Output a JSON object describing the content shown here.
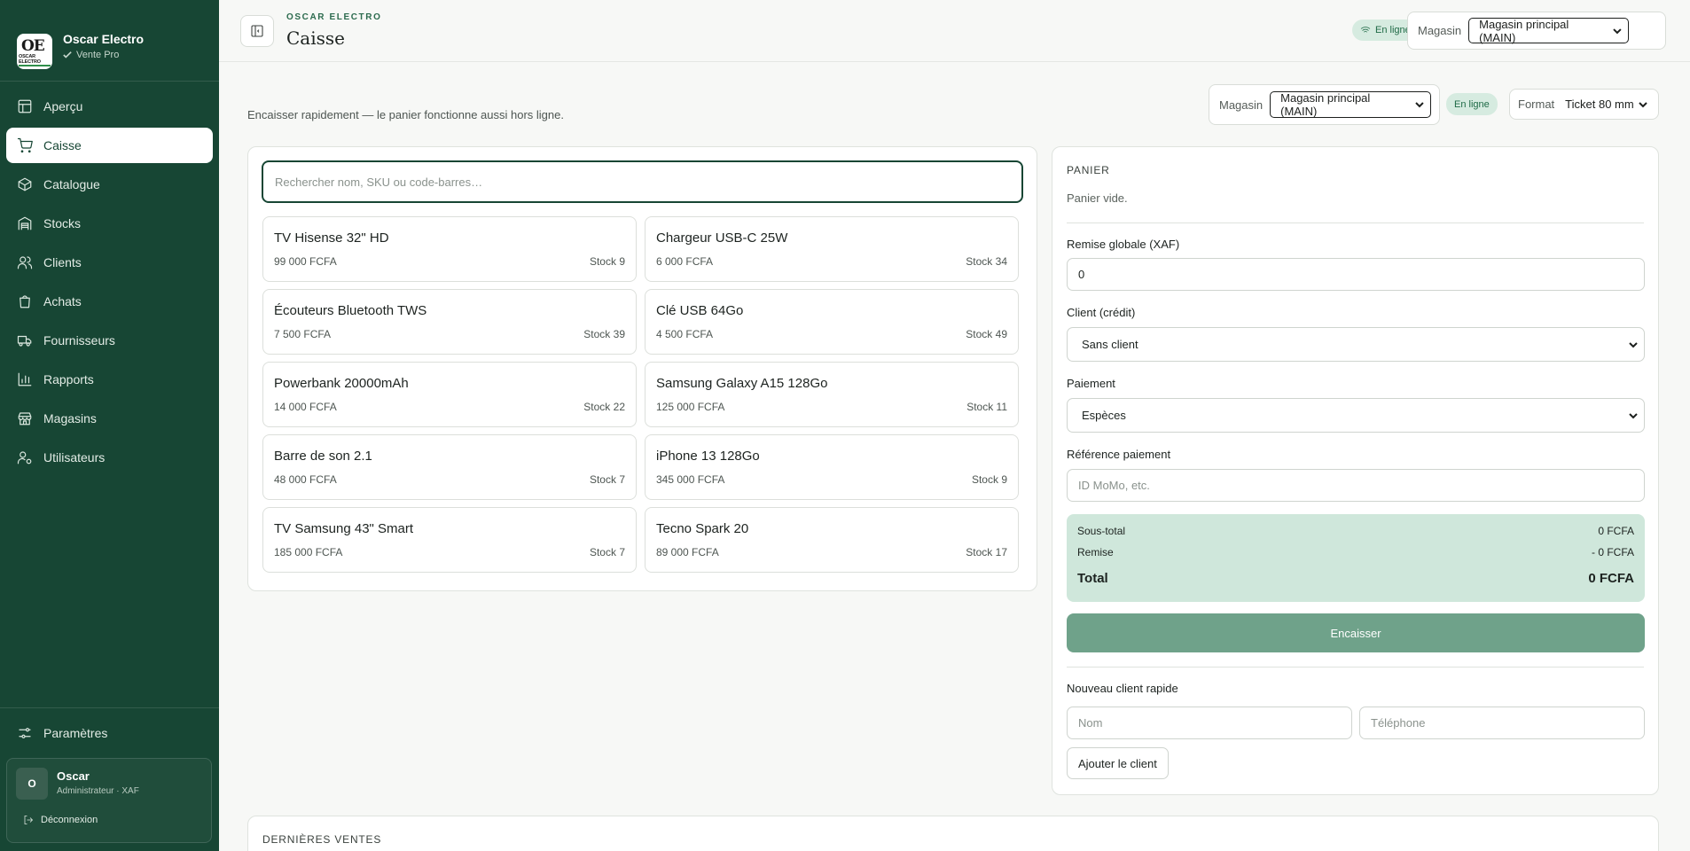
{
  "sidebar": {
    "brand_name": "Oscar Electro",
    "brand_sub": "Vente Pro",
    "logo_text": "OE",
    "logo_small": "OSCAR ELECTRO",
    "items": [
      {
        "label": "Aperçu",
        "icon": "layout-grid-icon"
      },
      {
        "label": "Caisse",
        "icon": "shopping-cart-icon",
        "active": true
      },
      {
        "label": "Catalogue",
        "icon": "package-icon"
      },
      {
        "label": "Stocks",
        "icon": "warehouse-icon"
      },
      {
        "label": "Clients",
        "icon": "users-icon"
      },
      {
        "label": "Achats",
        "icon": "shopping-bag-icon"
      },
      {
        "label": "Fournisseurs",
        "icon": "truck-icon"
      },
      {
        "label": "Rapports",
        "icon": "bar-chart-icon"
      },
      {
        "label": "Magasins",
        "icon": "store-icon"
      },
      {
        "label": "Utilisateurs",
        "icon": "user-cog-icon"
      }
    ],
    "settings_label": "Paramètres",
    "user": {
      "initial": "O",
      "name": "Oscar",
      "role": "Administrateur · XAF",
      "logout_label": "Déconnexion"
    }
  },
  "header": {
    "eyebrow": "OSCAR ELECTRO",
    "title": "Caisse",
    "online_label": "En ligne",
    "store_label": "Magasin",
    "store_value": "Magasin principal (MAIN)"
  },
  "main": {
    "subtitle": "Encaisser rapidement — le panier fonctionne aussi hors ligne.",
    "store_label": "Magasin",
    "store_value": "Magasin principal (MAIN)",
    "online_label": "En ligne",
    "format_label": "Format",
    "format_value": "Ticket 80 mm",
    "search_placeholder": "Rechercher nom, SKU ou code-barres…",
    "products": [
      {
        "name": "TV Hisense 32\" HD",
        "price": "99 000 FCFA",
        "stock": "Stock 9"
      },
      {
        "name": "Chargeur USB-C 25W",
        "price": "6 000 FCFA",
        "stock": "Stock 34"
      },
      {
        "name": "Écouteurs Bluetooth TWS",
        "price": "7 500 FCFA",
        "stock": "Stock 39"
      },
      {
        "name": "Clé USB 64Go",
        "price": "4 500 FCFA",
        "stock": "Stock 49"
      },
      {
        "name": "Powerbank 20000mAh",
        "price": "14 000 FCFA",
        "stock": "Stock 22"
      },
      {
        "name": "Samsung Galaxy A15 128Go",
        "price": "125 000 FCFA",
        "stock": "Stock 11"
      },
      {
        "name": "Barre de son 2.1",
        "price": "48 000 FCFA",
        "stock": "Stock 7"
      },
      {
        "name": "iPhone 13 128Go",
        "price": "345 000 FCFA",
        "stock": "Stock 9"
      },
      {
        "name": "TV Samsung 43\" Smart",
        "price": "185 000 FCFA",
        "stock": "Stock 7"
      },
      {
        "name": "Tecno Spark 20",
        "price": "89 000 FCFA",
        "stock": "Stock 17"
      }
    ]
  },
  "cart": {
    "heading": "PANIER",
    "empty_text": "Panier vide.",
    "discount_label": "Remise globale (XAF)",
    "discount_value": "0",
    "client_label": "Client (crédit)",
    "client_value": "Sans client",
    "payment_label": "Paiement",
    "payment_value": "Espèces",
    "reference_label": "Référence paiement",
    "reference_placeholder": "ID MoMo, etc.",
    "subtotal_label": "Sous-total",
    "subtotal_value": "0 FCFA",
    "discount_row_label": "Remise",
    "discount_row_value": "- 0 FCFA",
    "total_label": "Total",
    "total_value": "0 FCFA",
    "checkout_label": "Encaisser",
    "quick_client_label": "Nouveau client rapide",
    "name_placeholder": "Nom",
    "phone_placeholder": "Téléphone",
    "add_client_label": "Ajouter le client"
  },
  "recent": {
    "heading": "DERNIÈRES VENTES"
  },
  "colors": {
    "sidebar_bg": "#174634",
    "accent": "#174634",
    "online_pill_bg": "#d6ebe0",
    "totals_bg": "#cfe7db",
    "checkout_bg": "#6fa28a"
  }
}
